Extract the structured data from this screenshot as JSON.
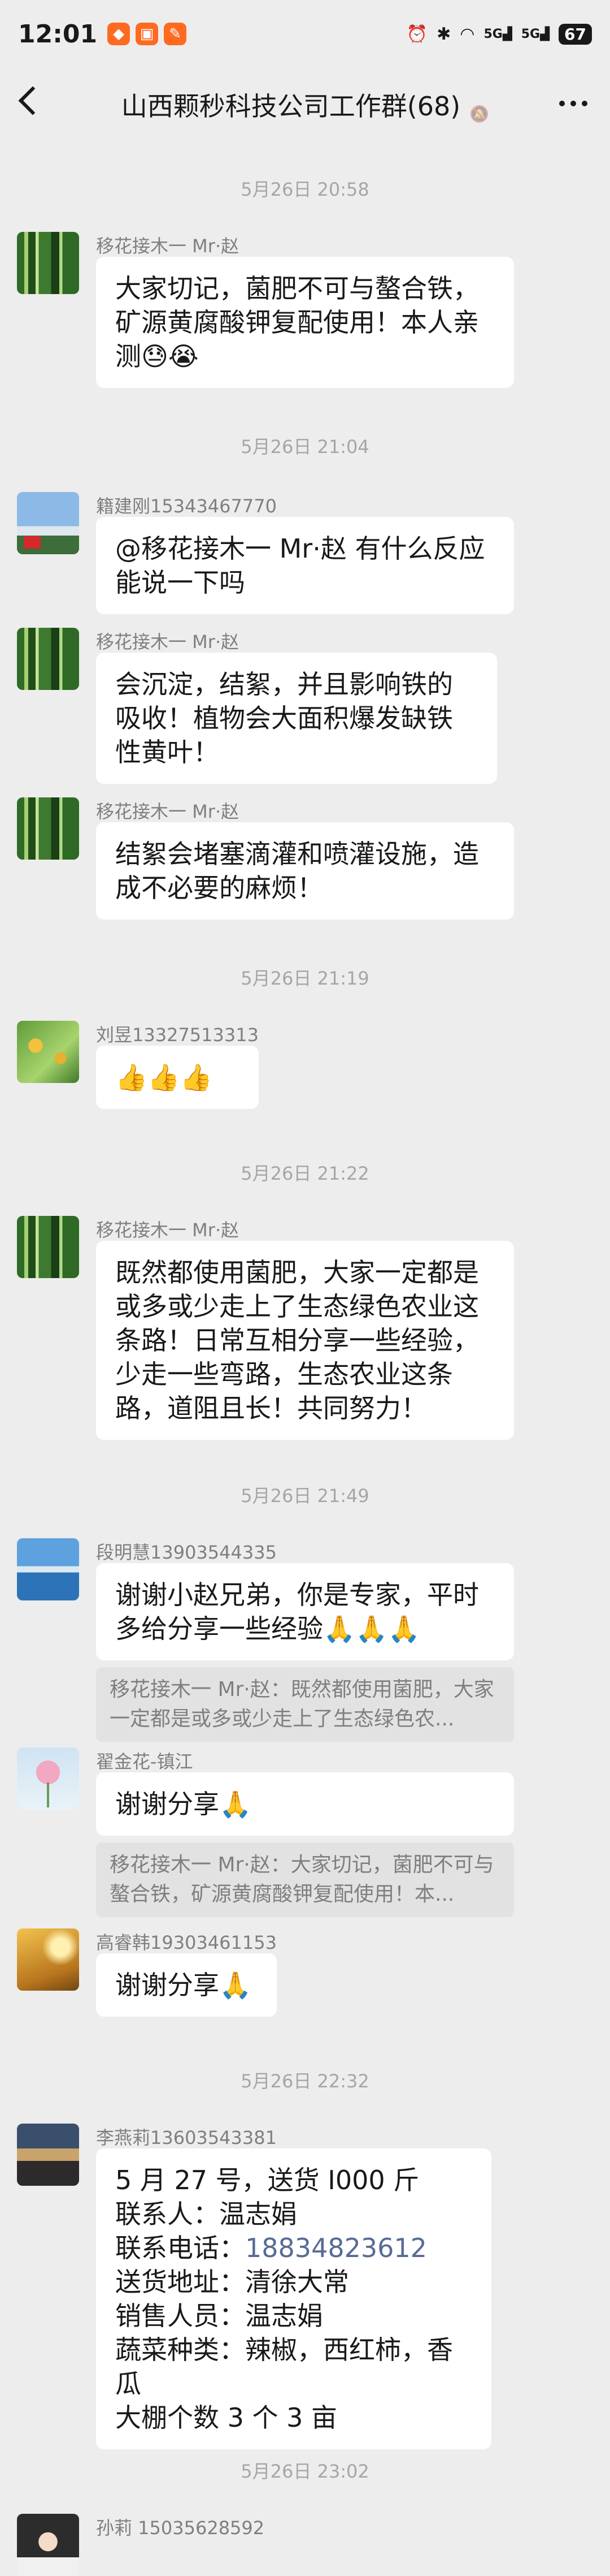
{
  "status_bar": {
    "time": "12:01",
    "signal1": "5G",
    "signal2": "5G",
    "battery": "67"
  },
  "header": {
    "title": "山西颗秒科技公司工作群(68)"
  },
  "timestamps": [
    "5月26日 20:58",
    "5月26日 21:04",
    "5月26日 21:19",
    "5月26日 21:22",
    "5月26日 21:49",
    "5月26日 22:32",
    "5月26日 23:02"
  ],
  "messages": [
    {
      "sender": "移花接木一 Mr·赵",
      "text": "大家切记，菌肥不可与螯合铁，矿源黄腐酸钾复配使用！本人亲测😓😭"
    },
    {
      "sender": "籍建刚15343467770",
      "text": "@移花接木一 Mr·赵  有什么反应能说一下吗"
    },
    {
      "sender": "移花接木一 Mr·赵",
      "text": "会沉淀，结絮，并且影响铁的吸收！植物会大面积爆发缺铁性黄叶！"
    },
    {
      "sender": "移花接木一 Mr·赵",
      "text": "结絮会堵塞滴灌和喷灌设施，造成不必要的麻烦！"
    },
    {
      "sender": "刘昱13327513313",
      "text": "👍👍👍"
    },
    {
      "sender": "移花接木一 Mr·赵",
      "text": "既然都使用菌肥，大家一定都是或多或少走上了生态绿色农业这条路！日常互相分享一些经验，少走一些弯路，生态农业这条路，道阻且长！共同努力！"
    },
    {
      "sender": "段明慧13903544335",
      "text": "谢谢小赵兄弟，你是专家，平时多给分享一些经验🙏🙏🙏",
      "quote": "移花接木一 Mr·赵：既然都使用菌肥，大家一定都是或多或少走上了生态绿色农..."
    },
    {
      "sender": "翟金花-镇江",
      "text": "谢谢分享🙏",
      "quote": "移花接木一 Mr·赵：大家切记，菌肥不可与螯合铁，矿源黄腐酸钾复配使用！本..."
    },
    {
      "sender": "高睿韩19303461153",
      "text": "谢谢分享🙏"
    },
    {
      "sender": "李燕莉13603543381",
      "lines": [
        "5 月 27 号，送货 I000 斤",
        "联系人：温志娟",
        "联系电话：",
        "送货地址：清徐大常",
        "销售人员：温志娟",
        "蔬菜种类：辣椒，西红柿，香瓜",
        "大棚个数 3 个  3 亩"
      ],
      "phone": "18834823612"
    },
    {
      "sender": "孙莉 15035628592"
    }
  ]
}
